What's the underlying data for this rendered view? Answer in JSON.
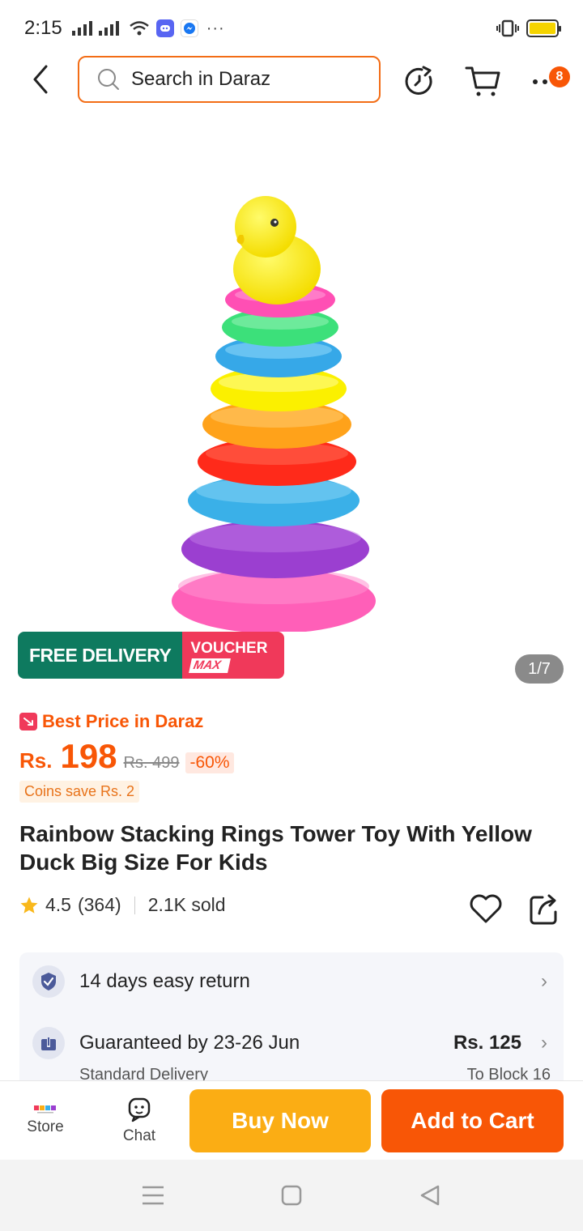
{
  "status_bar": {
    "time": "2:15",
    "dots": "···"
  },
  "header": {
    "search_placeholder": "Search in Daraz",
    "cart_badge": "8"
  },
  "gallery": {
    "free_delivery": "FREE DELIVERY",
    "voucher_label": "VOUCHER",
    "voucher_max": "MAX",
    "counter": "1/7"
  },
  "price": {
    "best_price": "Best Price in Daraz",
    "currency": "Rs.",
    "amount": "198",
    "original": "Rs. 499",
    "discount": "-60%",
    "coins": "Coins save Rs. 2"
  },
  "product": {
    "title": "Rainbow Stacking Rings Tower Toy With Yellow Duck Big Size For Kids",
    "rating": "4.5",
    "reviews": "(364)",
    "sold": "2.1K sold"
  },
  "info": {
    "returns": "14 days easy return",
    "delivery": "Guaranteed by 23-26 Jun",
    "delivery_price": "Rs. 125",
    "delivery_type": "Standard Delivery",
    "delivery_to": "To Block 16"
  },
  "bottom": {
    "store": "Store",
    "chat": "Chat",
    "buy_now": "Buy Now",
    "add_to_cart": "Add to Cart"
  },
  "colors": {
    "brand_orange": "#f85606",
    "buy_now_yellow": "#fbad14",
    "free_delivery_green": "#0e7a5f",
    "voucher_pink": "#f0395a"
  }
}
